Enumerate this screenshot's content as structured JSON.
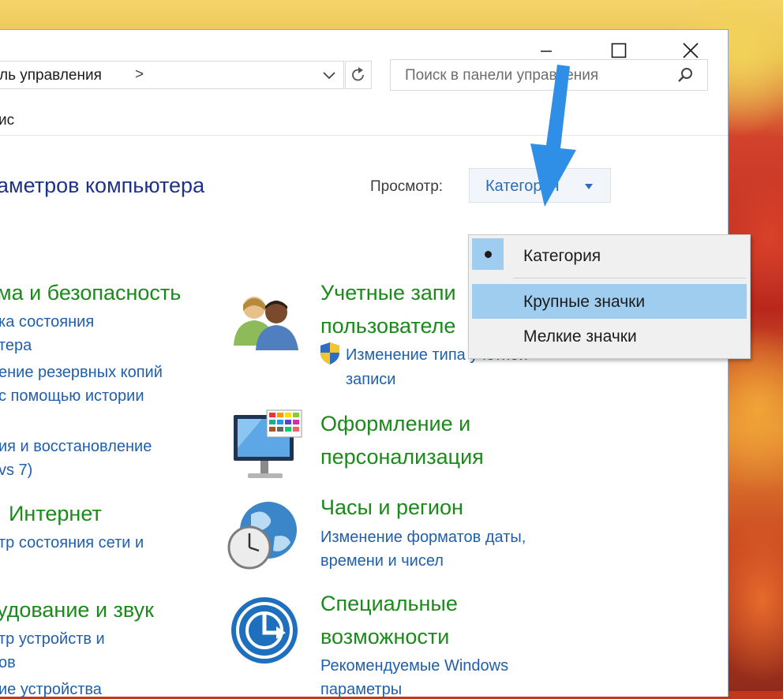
{
  "window": {
    "title_controls": [
      "minimize",
      "maximize",
      "close"
    ]
  },
  "address_bar": {
    "path_text": "ль управления",
    "chevron": ">"
  },
  "search": {
    "placeholder": "Поиск в панели управления"
  },
  "menubar": {
    "partial_item": "ис"
  },
  "page": {
    "title": "аметров компьютера"
  },
  "view": {
    "label": "Просмотр:",
    "selected": "Категория"
  },
  "view_menu": {
    "items": [
      {
        "label": "Категория",
        "checked": true
      },
      {
        "label": "Крупные значки",
        "highlighted": true
      },
      {
        "label": "Мелкие значки"
      }
    ]
  },
  "left_column": {
    "system_security": {
      "title": "ма и безопасность",
      "links": [
        "ка состояния",
        "тера",
        "ение резервных копий",
        "с помощью истории",
        "ия и восстановление",
        "vs 7)"
      ]
    },
    "network": {
      "title": "Интернет",
      "links": [
        "тр состояния сети и"
      ]
    },
    "hardware": {
      "title": "удование и звук",
      "links": [
        "тр устройств и",
        "ов",
        "ие устройства"
      ]
    }
  },
  "right_column": {
    "accounts": {
      "title_line1": "Учетные запи",
      "title_line2": "пользователе",
      "links": [
        "Изменение типа учетной",
        "записи"
      ]
    },
    "appearance": {
      "title_line1": "Оформление и",
      "title_line2": "персонализация"
    },
    "clock": {
      "title": "Часы и регион",
      "links": [
        "Изменение форматов даты,",
        "времени и чисел"
      ]
    },
    "ease": {
      "title_line1": "Специальные",
      "title_line2": "возможности",
      "links": [
        "Рекомендуемые Windows",
        "параметры"
      ]
    }
  },
  "colors": {
    "title_green": "#1a8a1a",
    "link_blue": "#1f5fac",
    "highlight": "#9fcdf0",
    "arrow": "#2f8fe6"
  }
}
